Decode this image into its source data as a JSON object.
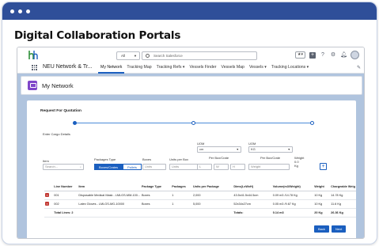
{
  "heading": "Digital Collaboration Portals",
  "header": {
    "search_scope": "All",
    "search_placeholder": "Search Salesforce",
    "favorites": "★▾"
  },
  "nav": {
    "app_name": "NEU Network & Tr...",
    "items": [
      "My Network",
      "Tracking Map",
      "Tracking Refs ▾",
      "Vessels Finder",
      "Vessels Map",
      "Vessels ▾",
      "Tracking Locations ▾"
    ]
  },
  "page": {
    "title": "My Network"
  },
  "form": {
    "title": "Request For Quotation",
    "section": "Enter Cargo Details",
    "item_label": "Item",
    "item_placeholder": "Search...",
    "packages_type_label": "Packages Type",
    "boxes_crates": "Boxes/Crates",
    "pallets": "Pallets",
    "boxes_label": "Boxes",
    "units_label": "Units",
    "units_per_box_label": "Units per Box",
    "units_placeholder": "Units",
    "uom_label_1": "UOM",
    "uom_value_1": "cm",
    "uom_label_2": "UOM",
    "uom_value_2": "KG",
    "per_box_dim_label": "Per Box/Crate",
    "dim_l": "L",
    "dim_w": "W",
    "dim_h": "H",
    "per_box_weight_label": "Per Box/Crate",
    "weight_placeholder": "Weight",
    "weight_unit_label": "Weight",
    "weight_unit_value": "0.0",
    "weight_unit_suffix": "Kg",
    "add": "+"
  },
  "table": {
    "headers": [
      "",
      "Line Number",
      "Item",
      "Package Type",
      "Packages",
      "Units per Package",
      "Dims(LxWxH)",
      "Volume(m3/Weight)",
      "Weight",
      "Chargeable Weig"
    ],
    "rows": [
      [
        "×",
        "001",
        "Disposable Medical Mask - LMLGS-MM-100...",
        "Boxes",
        "1",
        "2,000",
        "43.5x41.5x44.5cm",
        "0.09 m3 /14.78 Kg",
        "10 Kg",
        "14.78 Kg"
      ],
      [
        "×",
        "002",
        "Latex Gloves - LMLGS-MG-10000",
        "Boxes",
        "1",
        "5,000",
        "52x34x27cm",
        "0.05 m3 /9.67 Kg",
        "10 Kg",
        "11.6 Kg"
      ]
    ],
    "total_lines": "Total Lines: 2",
    "totals_label": "Totals:",
    "total_volume": "0.14 m3",
    "total_weight": "20 Kg",
    "total_chargeable": "26.36 Kg"
  },
  "buttons": {
    "back": "Back",
    "next": "Next"
  }
}
